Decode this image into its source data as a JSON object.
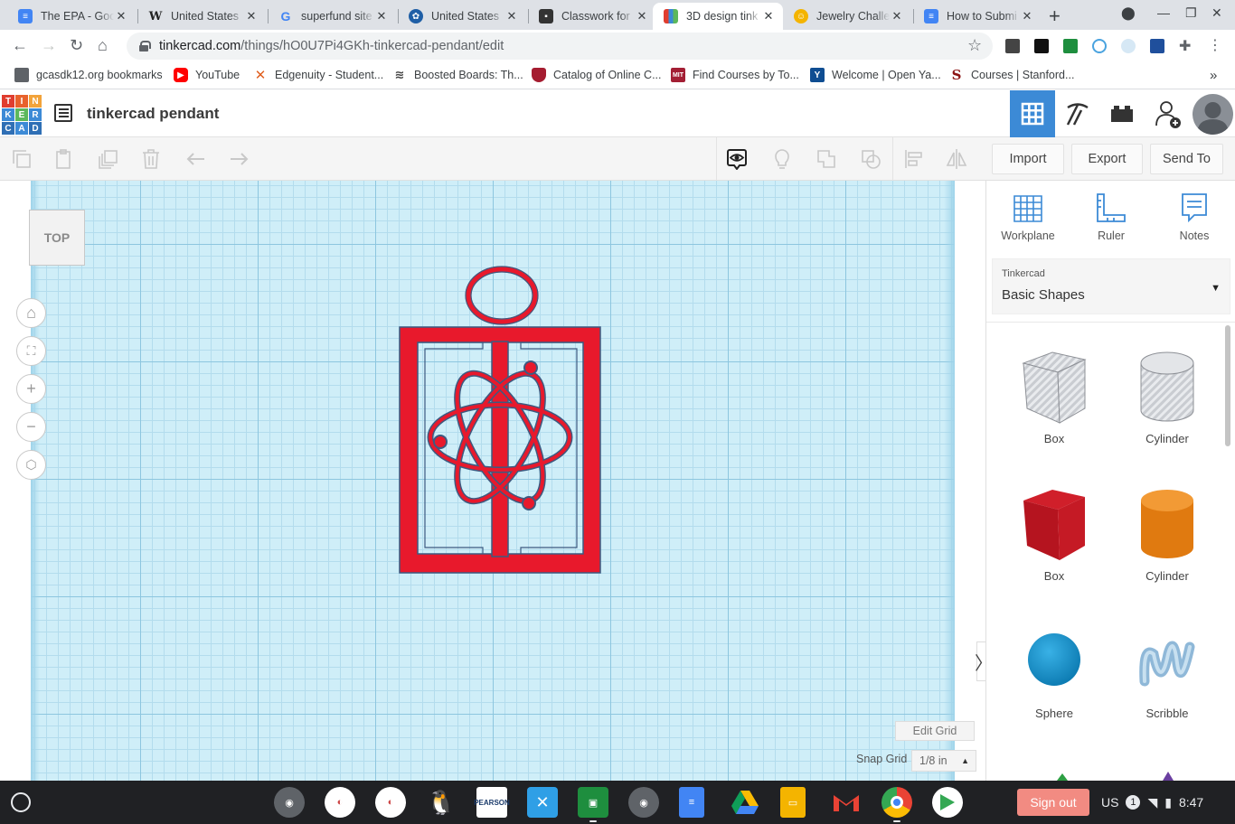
{
  "browser": {
    "tabs": [
      {
        "title": "The EPA - Goo",
        "favicon": "google-docs-icon",
        "color": "#4285f4"
      },
      {
        "title": "United States",
        "favicon": "wikipedia-icon",
        "color": "#ffffff"
      },
      {
        "title": "superfund site",
        "favicon": "google-icon",
        "color": "#ffffff"
      },
      {
        "title": "United States",
        "favicon": "epa-icon",
        "color": "#1f5fa6"
      },
      {
        "title": "Classwork for",
        "favicon": "classroom-icon",
        "color": "#333333"
      },
      {
        "title": "3D design tink",
        "favicon": "tinkercad-icon",
        "color": "#e03d2f"
      },
      {
        "title": "Jewelry Challe",
        "favicon": "jewelry-icon",
        "color": "#f4b400"
      },
      {
        "title": "How to Submi",
        "favicon": "google-docs-icon",
        "color": "#4285f4"
      }
    ],
    "active_tab": 5,
    "url_host": "tinkercad.com",
    "url_path": "/things/hO0U7Pi4GKh-tinkercad-pendant/edit"
  },
  "bookmarks": [
    {
      "label": "gcasdk12.org bookmarks",
      "icon": "folder-icon",
      "color": "#5f6368"
    },
    {
      "label": "YouTube",
      "icon": "youtube-icon",
      "color": "#ff0000"
    },
    {
      "label": "Edgenuity - Student...",
      "icon": "edgenuity-icon",
      "color": "#e06020"
    },
    {
      "label": "Boosted Boards: Th...",
      "icon": "boosted-icon",
      "color": "#444444"
    },
    {
      "label": "Catalog of Online C...",
      "icon": "harvard-icon",
      "color": "#a51c30"
    },
    {
      "label": "Find Courses by To...",
      "icon": "mit-icon",
      "color": "#a31f34"
    },
    {
      "label": "Welcome | Open Ya...",
      "icon": "yale-icon",
      "color": "#0f4d92"
    },
    {
      "label": "Courses | Stanford...",
      "icon": "stanford-icon",
      "color": "#8c1515"
    }
  ],
  "tinkercad": {
    "logo_letters": [
      "T",
      "I",
      "N",
      "K",
      "E",
      "R",
      "C",
      "A",
      "D"
    ],
    "title": "tinkercad pendant",
    "import": "Import",
    "export": "Export",
    "send_to": "Send To",
    "viewcube_label": "TOP",
    "edit_grid": "Edit Grid",
    "snap_grid_label": "Snap Grid",
    "snap_grid_value": "1/8 in",
    "panel_tools": [
      {
        "label": "Workplane",
        "icon": "workplane-icon"
      },
      {
        "label": "Ruler",
        "icon": "ruler-icon"
      },
      {
        "label": "Notes",
        "icon": "notes-icon"
      }
    ],
    "library_small_label": "Tinkercad",
    "library_value": "Basic Shapes",
    "shapes": [
      {
        "label": "Box",
        "kind": "hole-box"
      },
      {
        "label": "Cylinder",
        "kind": "hole-cylinder"
      },
      {
        "label": "Box",
        "kind": "box"
      },
      {
        "label": "Cylinder",
        "kind": "cylinder"
      },
      {
        "label": "Sphere",
        "kind": "sphere"
      },
      {
        "label": "Scribble",
        "kind": "scribble"
      }
    ],
    "colors": {
      "accent": "#3c8ad6",
      "pendant_red": "#e8192c",
      "grid_bg": "#cfeef8"
    }
  },
  "shelf": {
    "sign_out": "Sign out",
    "locale": "US",
    "notification_count": "1",
    "time": "8:47"
  }
}
